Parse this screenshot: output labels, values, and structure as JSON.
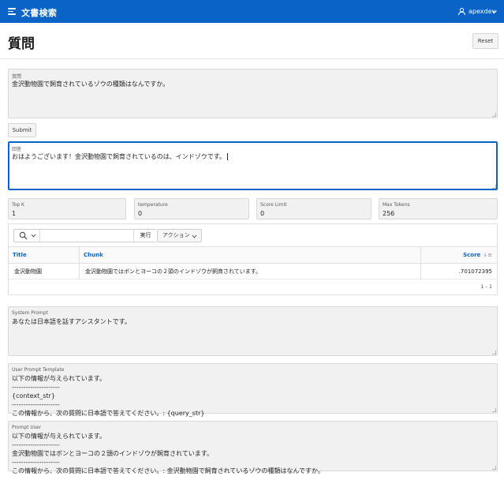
{
  "app": {
    "title": "文書検索",
    "user": "apexdev"
  },
  "page": {
    "title": "質問",
    "reset_label": "Reset",
    "submit_label": "Submit"
  },
  "question": {
    "label": "質問",
    "value": "金沢動物園で飼育されているゾウの種類はなんですか。"
  },
  "answer": {
    "label": "回答",
    "value": "おはようございます！金沢動物園で飼育されているのは、インドゾウです。"
  },
  "params": [
    {
      "label": "Top K",
      "value": "1"
    },
    {
      "label": "temperature",
      "value": "0"
    },
    {
      "label": "Score Limit",
      "value": "0"
    },
    {
      "label": "Max Tokens",
      "value": "256"
    }
  ],
  "report": {
    "search_placeholder": "",
    "go_label": "実行",
    "actions_label": "アクション",
    "columns": {
      "title": "Title",
      "chunk": "Chunk",
      "score": "Score"
    },
    "rows": [
      {
        "title": "金沢動物園",
        "chunk": "金沢動物園ではボンとヨーコの２頭のインドゾウが飼育されています。",
        "score": ".701072395"
      }
    ],
    "pagination": "1 - 1"
  },
  "system_prompt": {
    "label": "System Prompt",
    "value": "あなたは日本語を話すアシスタントです。"
  },
  "user_prompt_template": {
    "label": "User Prompt Template",
    "value": "以下の情報が与えられています。\n---------------------\n{context_str}\n---------------------\nこの情報から、次の質問に日本語で答えてください。: {query_str}"
  },
  "prompt_user": {
    "label": "Prompt User",
    "value": "以下の情報が与えられています。\n---------------------\n金沢動物園ではボンとヨーコの２頭のインドゾウが飼育されています。\n---------------------\nこの情報から、次の質問に日本語で答えてください。: 金沢動物園で飼育されているゾウの種類はなんですか。"
  }
}
